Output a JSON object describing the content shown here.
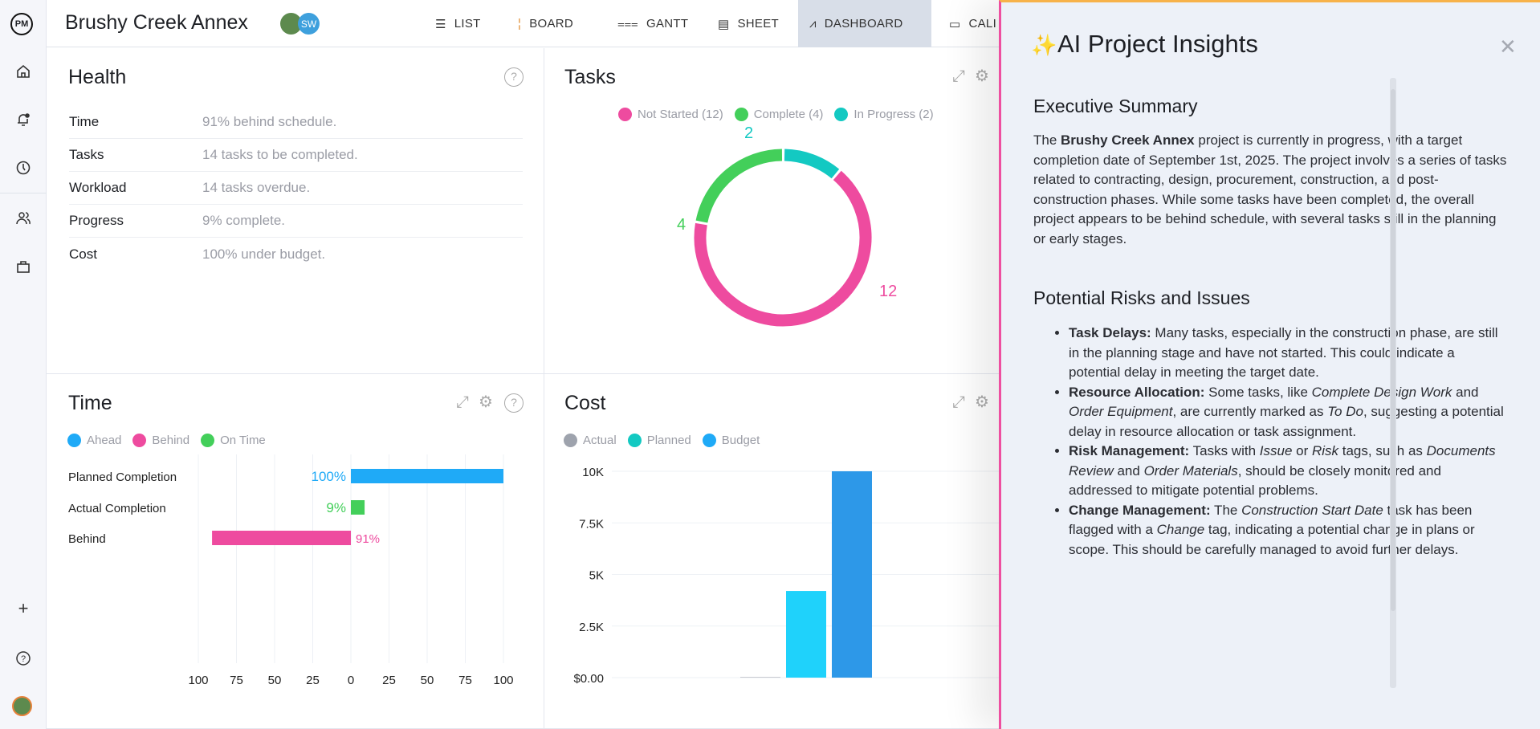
{
  "app": {
    "logo": "PM",
    "project_title": "Brushy Creek Annex",
    "avatars": [
      {
        "initials": "SW",
        "color": "#3ea0dd"
      }
    ]
  },
  "nav_tabs": [
    {
      "label": "LIST",
      "icon": "list-icon"
    },
    {
      "label": "BOARD",
      "icon": "board-icon"
    },
    {
      "label": "GANTT",
      "icon": "gantt-icon"
    },
    {
      "label": "SHEET",
      "icon": "sheet-icon"
    },
    {
      "label": "DASHBOARD",
      "icon": "dashboard-icon",
      "active": true
    },
    {
      "label": "CALI",
      "icon": "calendar-icon"
    }
  ],
  "sidebar": {
    "items": [
      "home-icon",
      "bell-icon",
      "clock-icon",
      "people-icon",
      "briefcase-icon",
      "plus-icon",
      "help-icon",
      "avatar"
    ]
  },
  "health": {
    "title": "Health",
    "rows": [
      {
        "label": "Time",
        "value": "91% behind schedule."
      },
      {
        "label": "Tasks",
        "value": "14 tasks to be completed."
      },
      {
        "label": "Workload",
        "value": "14 tasks overdue."
      },
      {
        "label": "Progress",
        "value": "9% complete."
      },
      {
        "label": "Cost",
        "value": "100% under budget."
      }
    ]
  },
  "tasks": {
    "title": "Tasks"
  },
  "time": {
    "title": "Time"
  },
  "cost": {
    "title": "Cost"
  },
  "chart_data": [
    {
      "type": "pie",
      "title": "Tasks",
      "donut": true,
      "categories": [
        "Not Started",
        "Complete",
        "In Progress"
      ],
      "legend": [
        "Not Started (12)",
        "Complete (4)",
        "In Progress (2)"
      ],
      "values": [
        12,
        4,
        2
      ],
      "colors": [
        "#ee4b9f",
        "#43cf5a",
        "#13c9c2"
      ],
      "legend_position": "top"
    },
    {
      "type": "bar",
      "orientation": "horizontal",
      "title": "Time",
      "legend": [
        {
          "name": "Ahead",
          "color": "#1faaf7"
        },
        {
          "name": "Behind",
          "color": "#ee4b9f"
        },
        {
          "name": "On Time",
          "color": "#43cf5a"
        }
      ],
      "categories": [
        "Planned Completion",
        "Actual Completion",
        "Behind"
      ],
      "values": [
        100,
        9,
        -91
      ],
      "data_labels": [
        "100%",
        "9%",
        "91%"
      ],
      "colors": [
        "#1faaf7",
        "#43cf5a",
        "#ee4b9f"
      ],
      "x_ticks": [
        "100",
        "75",
        "50",
        "25",
        "0",
        "25",
        "50",
        "75",
        "100"
      ],
      "xlim": [
        -100,
        100
      ],
      "grid": true
    },
    {
      "type": "bar",
      "title": "Cost",
      "legend": [
        {
          "name": "Actual",
          "color": "#9ea3ad"
        },
        {
          "name": "Planned",
          "color": "#13c9c2"
        },
        {
          "name": "Budget",
          "color": "#1faaf7"
        }
      ],
      "series": [
        {
          "name": "Actual",
          "value": 0,
          "color": "#c7cad0"
        },
        {
          "name": "Planned",
          "value": 4200,
          "color": "#1fd2fb"
        },
        {
          "name": "Budget",
          "value": 10000,
          "color": "#2d98e8"
        }
      ],
      "y_ticks": [
        "$0.00",
        "2.5K",
        "5K",
        "7.5K",
        "10K"
      ],
      "ylim": [
        0,
        10000
      ],
      "grid": true
    }
  ],
  "ai_panel": {
    "title": "AI Project Insights",
    "summary_heading": "Executive Summary",
    "summary": {
      "pre": "The ",
      "bold": "Brushy Creek Annex",
      "post": " project is currently in progress, with a target completion date of September 1st, 2025. The project involves a series of tasks related to contracting, design, procurement, construction, and post-construction phases. While some tasks have been completed, the overall project appears to be behind schedule, with several tasks still in the planning or early stages."
    },
    "risks_heading": "Potential Risks and Issues",
    "risks": [
      {
        "title": "Task Delays:",
        "parts": [
          " Many tasks, especially in the construction phase, are still in the planning stage and have not started. This could indicate a potential delay in meeting the target date."
        ]
      },
      {
        "title": "Resource Allocation:",
        "parts": [
          " Some tasks, like ",
          {
            "i": "Complete Design Work"
          },
          " and ",
          {
            "i": "Order Equipment"
          },
          ", are currently marked as ",
          {
            "i": "To Do"
          },
          ", suggesting a potential delay in resource allocation or task assignment."
        ]
      },
      {
        "title": "Risk Management:",
        "parts": [
          " Tasks with ",
          {
            "i": "Issue"
          },
          " or ",
          {
            "i": "Risk"
          },
          " tags, such as ",
          {
            "i": "Documents Review"
          },
          " and ",
          {
            "i": "Order Materials"
          },
          ", should be closely monitored and addressed to mitigate potential problems."
        ]
      },
      {
        "title": "Change Management:",
        "parts": [
          " The ",
          {
            "i": "Construction Start Date"
          },
          " task has been flagged with a ",
          {
            "i": "Change"
          },
          " tag, indicating a potential change in plans or scope. This should be carefully managed to avoid further delays."
        ]
      }
    ]
  }
}
